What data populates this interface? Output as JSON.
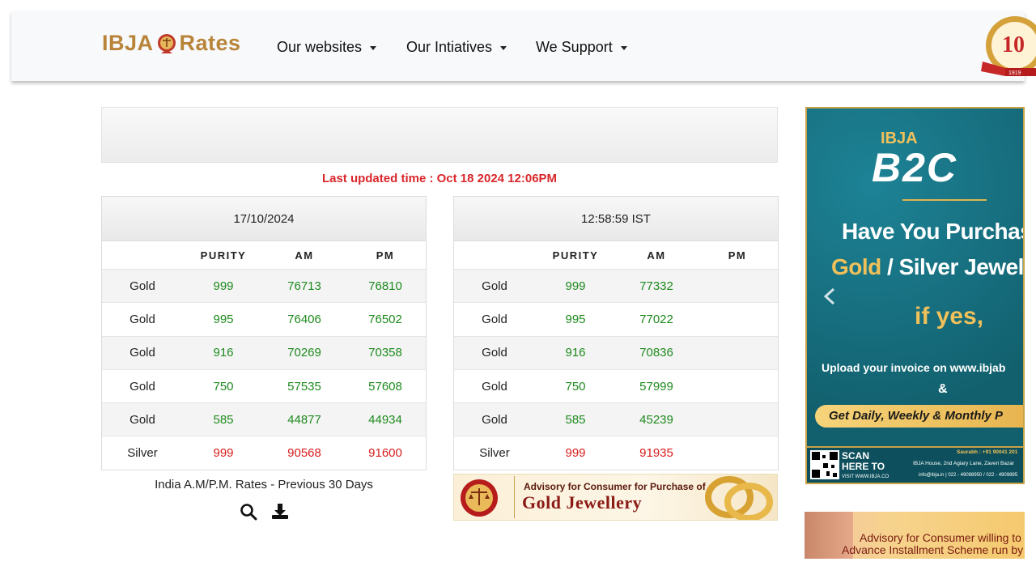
{
  "header": {
    "logo_text_left": "IBJA",
    "logo_text_right": "Rates",
    "nav": [
      {
        "label": "Our websites"
      },
      {
        "label": "Our Intiatives"
      },
      {
        "label": "We Support"
      }
    ],
    "badge_text": "10",
    "badge_year": "1919"
  },
  "last_updated": "Last updated time : Oct 18 2024 12:06PM",
  "table_left": {
    "heading": "17/10/2024",
    "columns": [
      "",
      "PURITY",
      "AM",
      "PM"
    ],
    "rows": [
      {
        "metal": "Gold",
        "purity": "999",
        "am": "76713",
        "pm": "76810"
      },
      {
        "metal": "Gold",
        "purity": "995",
        "am": "76406",
        "pm": "76502"
      },
      {
        "metal": "Gold",
        "purity": "916",
        "am": "70269",
        "pm": "70358"
      },
      {
        "metal": "Gold",
        "purity": "750",
        "am": "57535",
        "pm": "57608"
      },
      {
        "metal": "Gold",
        "purity": "585",
        "am": "44877",
        "pm": "44934"
      },
      {
        "metal": "Silver",
        "purity": "999",
        "am": "90568",
        "pm": "91600"
      }
    ]
  },
  "table_right": {
    "heading": "12:58:59 IST",
    "columns": [
      "",
      "PURITY",
      "AM",
      "PM"
    ],
    "rows": [
      {
        "metal": "Gold",
        "purity": "999",
        "am": "77332",
        "pm": ""
      },
      {
        "metal": "Gold",
        "purity": "995",
        "am": "77022",
        "pm": ""
      },
      {
        "metal": "Gold",
        "purity": "916",
        "am": "70836",
        "pm": ""
      },
      {
        "metal": "Gold",
        "purity": "750",
        "am": "57999",
        "pm": ""
      },
      {
        "metal": "Gold",
        "purity": "585",
        "am": "45239",
        "pm": ""
      },
      {
        "metal": "Silver",
        "purity": "999",
        "am": "91935",
        "pm": ""
      }
    ]
  },
  "previous_rates_label": "India A.M/P.M. Rates - Previous 30 Days",
  "icons": {
    "search": "search-icon",
    "download": "download-icon"
  },
  "advisory_banner": {
    "line1": "Advisory for Consumer for Purchase of",
    "line2": "Gold Jewellery"
  },
  "side_ad": {
    "brand": "IBJA",
    "brand_big": "B2C",
    "headline1": "Have You Purchase",
    "headline2a": "Gold",
    "headline2b": " / Silver Jewelle",
    "if_yes": "if yes,",
    "upload": "Upload your invoice on www.ibjab",
    "amp": "&",
    "cta": "Get Daily, Weekly & Monthly P",
    "scan1": "SCAN",
    "scan2": "HERE TO",
    "visit": "VISIT WWW.IBJA.CO",
    "contact1": "Saurabh : +91 90041 201",
    "contact2": "IBJA House, 2nd Agiary Lane, Zaveri Bazar",
    "contact3": "info@ibja.in  |  022 - 49098950 / 022 - 4909895"
  },
  "advisory_banner2": {
    "line1": "Advisory for Consumer willing to i",
    "line2": "Advance Installment Scheme run by"
  },
  "colors": {
    "accent_gold": "#b8843a",
    "rate_green": "#1e8a1e",
    "rate_red": "#d91d1d",
    "update_red": "#d9262b",
    "ad_teal": "#17707f"
  }
}
